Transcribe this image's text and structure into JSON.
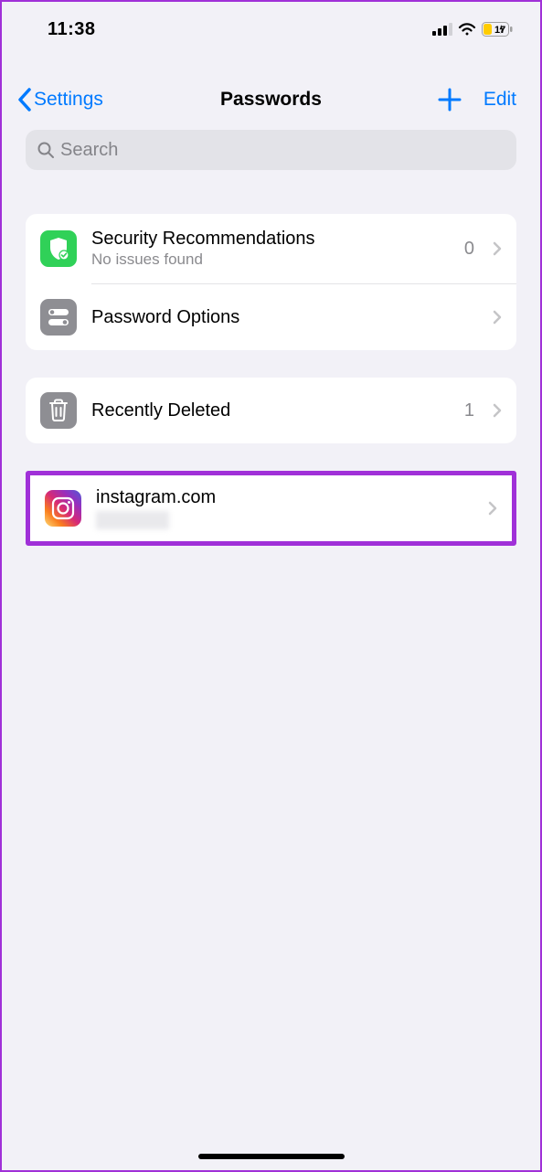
{
  "statusBar": {
    "time": "11:38",
    "batteryPercent": "17"
  },
  "nav": {
    "back": "Settings",
    "title": "Passwords",
    "edit": "Edit"
  },
  "search": {
    "placeholder": "Search"
  },
  "sections": {
    "security": {
      "title": "Security Recommendations",
      "subtitle": "No issues found",
      "count": "0"
    },
    "options": {
      "title": "Password Options"
    },
    "deleted": {
      "title": "Recently Deleted",
      "count": "1"
    },
    "instagram": {
      "title": "instagram.com"
    }
  }
}
